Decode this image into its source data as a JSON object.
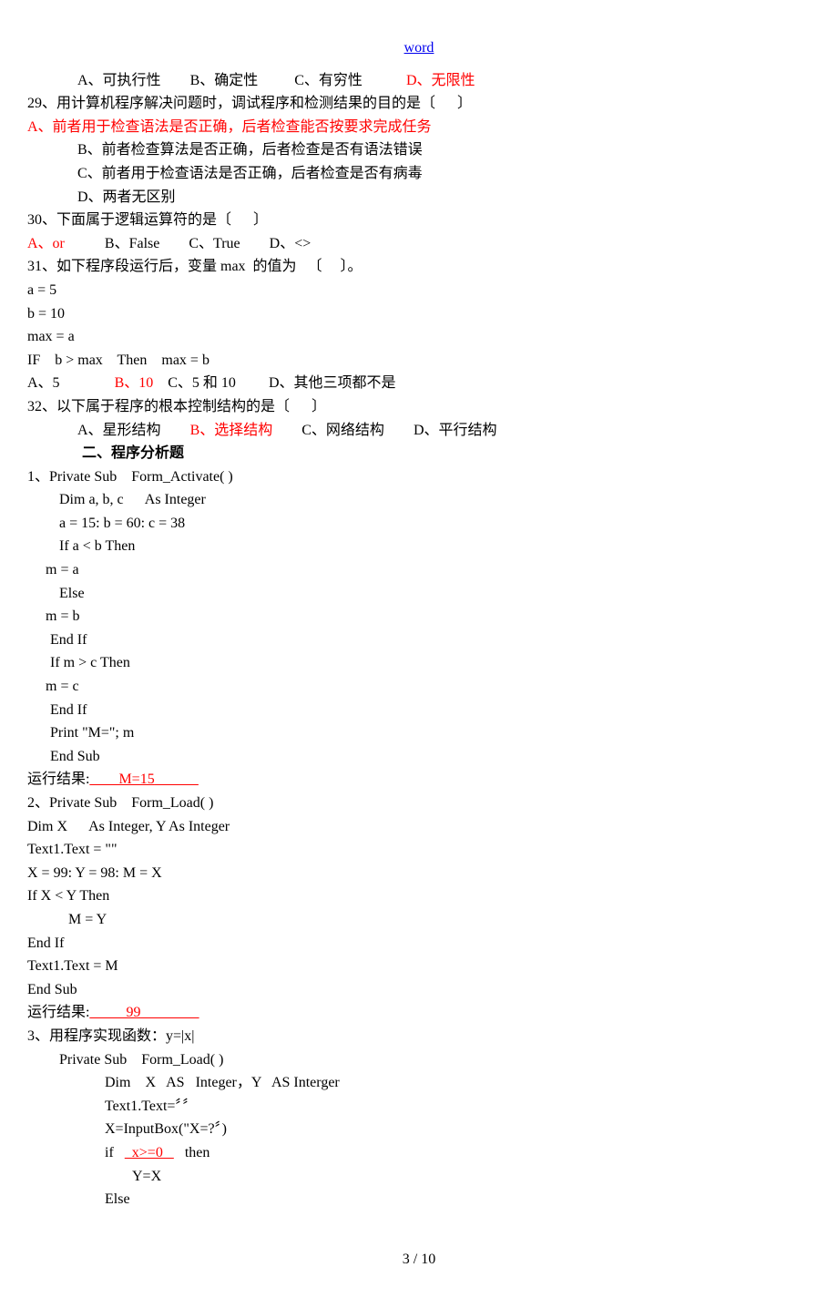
{
  "header": {
    "title": "word"
  },
  "q28": {
    "a": "A、可执行性",
    "b": "B、确定性",
    "c": "C、有穷性",
    "d": "D、无限性"
  },
  "q29": {
    "text": "29、用计算机程序解决问题时，调试程序和检测结果的目的是〔      〕",
    "a": "A、前者用于检查语法是否正确，后者检查能否按要求完成任务",
    "b": "B、前者检查算法是否正确，后者检查是否有语法错误",
    "c": "C、前者用于检查语法是否正确，后者检查是否有病毒",
    "d": "D、两者无区别"
  },
  "q30": {
    "text": "30、下面属于逻辑运算符的是〔      〕",
    "a": "A、or",
    "b": "B、False",
    "c": "C、True",
    "d": "D、<>"
  },
  "q31": {
    "text": "31、如下程序段运行后，变量 max  的值为   〔     〕。",
    "code1": "a = 5",
    "code2": "b = 10",
    "code3": "max = a",
    "code4": "IF    b > max    Then    max = b",
    "a": "A、5",
    "b": "B、10",
    "c": "C、5 和 10",
    "d": "D、其他三项都不是"
  },
  "q32": {
    "text": "32、以下属于程序的根本控制结构的是〔      〕",
    "a": "A、星形结构",
    "b": "B、选择结构",
    "c": "C、网络结构",
    "d": "D、平行结构"
  },
  "section2": {
    "title": "二、程序分析题"
  },
  "prog1": {
    "q": "1、Private Sub    Form_Activate( )",
    "dim": "Dim a, b, c      As Integer",
    "l1": "a = 15: b = 60: c = 38",
    "l2": "If a < b Then",
    "l3": "m = a",
    "l4": "Else",
    "l5": "m = b",
    "l6": "End If",
    "l7": "If m > c Then",
    "l8": "m = c",
    "l9": "End If",
    "l10": "Print \"M=\"; m",
    "l11": "End Sub",
    "result_label": "运行结果:",
    "result_blank1": "____",
    "result_val": "M=15",
    "result_blank2": "______"
  },
  "prog2": {
    "q": "2、Private Sub    Form_Load( )",
    "l1": "Dim X      As Integer, Y As Integer",
    "l2": "Text1.Text = \"\"",
    "l3": "X = 99: Y = 98: M = X",
    "l4": "If X < Y Then",
    "l5": "M = Y",
    "l6": "End If",
    "l7": "Text1.Text = M",
    "l8": "End Sub",
    "result_label": "运行结果:",
    "result_blank1": "_____",
    "result_val": "99",
    "result_blank2": "________"
  },
  "prog3": {
    "q": "3、用程序实现函数：y=|x|",
    "l1": "Private Sub    Form_Load( )",
    "l2": "Dim    X   AS   Integer，Y   AS Interger",
    "l3": "Text1.Text=〞〞",
    "l4": "X=InputBox(\"X=?〞)",
    "l5a": "if   ",
    "l5b": "  x>=0   ",
    "l5c": "   then",
    "l6": "Y=X",
    "l7": "Else"
  },
  "footer": {
    "page": "3  / 10"
  }
}
